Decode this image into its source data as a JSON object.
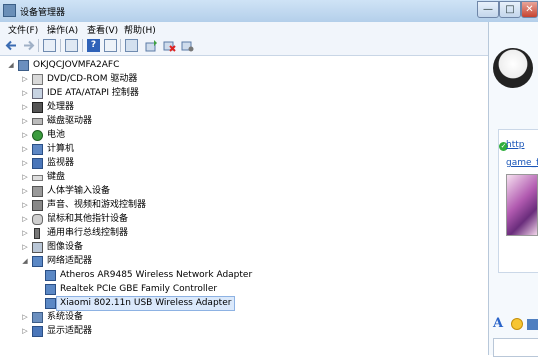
{
  "window": {
    "title": "设备管理器",
    "min": "—",
    "max": "□",
    "close": "✕"
  },
  "menu": [
    {
      "label": "文件(F)"
    },
    {
      "label": "操作(A)"
    },
    {
      "label": "查看(V)"
    },
    {
      "label": "帮助(H)"
    }
  ],
  "toolbar_icons": [
    "back-icon",
    "forward-icon",
    "console-tree-icon",
    "properties-icon",
    "help-icon",
    "view-icon",
    "scan-hardware-icon",
    "update-driver-icon",
    "uninstall-icon",
    "disable-icon"
  ],
  "tree": {
    "root": "OKJQCJOVMFA2AFC",
    "categories": [
      {
        "label": "DVD/CD-ROM 驱动器",
        "icon": "dvd-drive-icon"
      },
      {
        "label": "IDE ATA/ATAPI 控制器",
        "icon": "ide-controller-icon"
      },
      {
        "label": "处理器",
        "icon": "processor-icon"
      },
      {
        "label": "磁盘驱动器",
        "icon": "disk-drive-icon"
      },
      {
        "label": "电池",
        "icon": "battery-icon"
      },
      {
        "label": "计算机",
        "icon": "computer-icon"
      },
      {
        "label": "监视器",
        "icon": "monitor-icon"
      },
      {
        "label": "键盘",
        "icon": "keyboard-icon"
      },
      {
        "label": "人体学输入设备",
        "icon": "hid-icon"
      },
      {
        "label": "声音、视频和游戏控制器",
        "icon": "sound-icon"
      },
      {
        "label": "鼠标和其他指针设备",
        "icon": "mouse-icon"
      },
      {
        "label": "通用串行总线控制器",
        "icon": "usb-icon"
      },
      {
        "label": "图像设备",
        "icon": "imaging-device-icon"
      },
      {
        "label": "网络适配器",
        "icon": "network-adapter-icon"
      },
      {
        "label": "系统设备",
        "icon": "system-device-icon"
      },
      {
        "label": "显示适配器",
        "icon": "display-adapter-icon"
      }
    ],
    "network_children": [
      {
        "label": "Atheros AR9485 Wireless Network Adapter"
      },
      {
        "label": "Realtek PCIe GBE Family Controller"
      },
      {
        "label": "Xiaomi 802.11n USB Wireless Adapter",
        "selected": true
      }
    ]
  },
  "chat": {
    "link1": "http",
    "link2": "game_f",
    "font_label": "A"
  },
  "colors": {
    "titlebar": "#c4dbf2",
    "selection": "#dbe9fb",
    "link": "#1a56b8"
  }
}
